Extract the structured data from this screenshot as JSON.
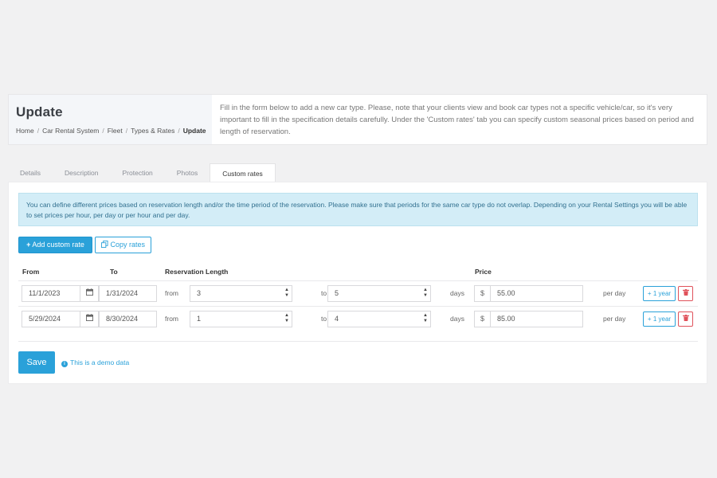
{
  "header": {
    "title": "Update",
    "breadcrumb": [
      "Home",
      "Car Rental System",
      "Fleet",
      "Types & Rates",
      "Update"
    ],
    "description": "Fill in the form below to add a new car type. Please, note that your clients view and book car types not a specific vehicle/car, so it's very important to fill in the specification details carefully. Under the 'Custom rates' tab you can specify custom seasonal prices based on period and length of reservation."
  },
  "tabs": [
    "Details",
    "Description",
    "Protection",
    "Photos",
    "Custom rates"
  ],
  "active_tab": "Custom rates",
  "info_message": "You can define different prices based on reservation length and/or the time period of the reservation. Please make sure that periods for the same car type do not overlap. Depending on your Rental Settings you will be able to set prices per hour, per day or per hour and per day.",
  "buttons": {
    "add_custom_rate": "Add custom rate",
    "copy_rates": "Copy rates",
    "save": "Save",
    "add_year": "+ 1 year"
  },
  "columns": {
    "from": "From",
    "to": "To",
    "reservation_length": "Reservation Length",
    "price": "Price"
  },
  "labels": {
    "from": "from",
    "to": "to",
    "days": "days",
    "currency": "$",
    "per_day": "per day"
  },
  "rates": [
    {
      "date_from": "11/1/2023",
      "date_to": "1/31/2024",
      "length_from": "3",
      "length_to": "5",
      "price": "55.00"
    },
    {
      "date_from": "5/29/2024",
      "date_to": "8/30/2024",
      "length_from": "1",
      "length_to": "4",
      "price": "85.00"
    }
  ],
  "demo_note": "This is a demo data",
  "colors": {
    "primary": "#2aa1d9",
    "danger": "#e0525b",
    "info_bg": "#d3edf7",
    "info_text": "#31708f"
  },
  "icons": {
    "calendar": "calendar-icon",
    "plus": "plus-icon",
    "copy": "copy-icon",
    "trash": "trash-icon",
    "info": "info-icon"
  }
}
